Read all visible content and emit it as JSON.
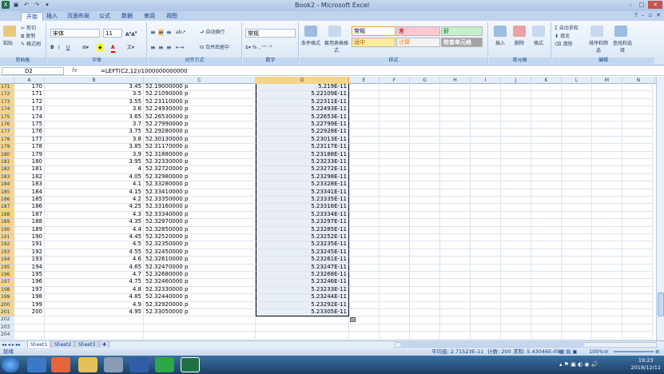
{
  "window": {
    "title": "Book2 - Microsoft Excel"
  },
  "tabs": [
    "开始",
    "插入",
    "页面布局",
    "公式",
    "数据",
    "审阅",
    "视图"
  ],
  "ribbon": {
    "clipboard": {
      "label": "剪贴板",
      "paste": "粘贴",
      "cut": "剪切",
      "copy": "复制",
      "format_painter": "格式刷"
    },
    "font": {
      "label": "字体",
      "name": "宋体",
      "size": "11"
    },
    "alignment": {
      "label": "对齐方式",
      "wrap": "自动换行",
      "merge": "合并后居中"
    },
    "number": {
      "label": "数字",
      "format": "常规"
    },
    "styles": {
      "label": "样式",
      "conditional": "条件格式",
      "table": "套用表格格式",
      "cells": {
        "normal": "常规",
        "bad": "差",
        "good": "好",
        "neutral": "适中",
        "calc": "计算",
        "check": "检查单元格"
      }
    },
    "cells": {
      "label": "单元格",
      "insert": "插入",
      "delete": "删除",
      "format": "格式"
    },
    "editing": {
      "label": "编辑",
      "autosum": "自动求和",
      "fill": "填充",
      "clear": "清除",
      "sort": "排序和筛选",
      "find": "查找和选择"
    }
  },
  "formula_bar": {
    "name_box": "D2",
    "fx": "fx",
    "formula": "=LEFT(C2,12)/1000000000000"
  },
  "columns": [
    "A",
    "B",
    "C",
    "D",
    "E",
    "F",
    "G",
    "H",
    "I",
    "J",
    "K",
    "L",
    "M",
    "N"
  ],
  "rows": [
    {
      "n": "171",
      "a": "170",
      "b": "3.45",
      "c": "52.19000000 p",
      "d": "5.219E-11"
    },
    {
      "n": "172",
      "a": "171",
      "b": "3.5",
      "c": "52.21090000 p",
      "d": "5.22109E-11"
    },
    {
      "n": "173",
      "a": "172",
      "b": "3.55",
      "c": "52.23110000 p",
      "d": "5.22311E-11"
    },
    {
      "n": "174",
      "a": "173",
      "b": "3.6",
      "c": "52.24930000 p",
      "d": "5.22493E-11"
    },
    {
      "n": "175",
      "a": "174",
      "b": "3.65",
      "c": "52.26530000 p",
      "d": "5.22653E-11"
    },
    {
      "n": "176",
      "a": "175",
      "b": "3.7",
      "c": "52.27990000 p",
      "d": "5.22799E-11"
    },
    {
      "n": "177",
      "a": "176",
      "b": "3.75",
      "c": "52.29280000 p",
      "d": "5.22928E-11"
    },
    {
      "n": "178",
      "a": "177",
      "b": "3.8",
      "c": "52.30130000 p",
      "d": "5.23013E-11"
    },
    {
      "n": "179",
      "a": "178",
      "b": "3.85",
      "c": "52.31170000 p",
      "d": "5.23117E-11"
    },
    {
      "n": "180",
      "a": "179",
      "b": "3.9",
      "c": "52.31880000 p",
      "d": "5.23188E-11"
    },
    {
      "n": "181",
      "a": "180",
      "b": "3.95",
      "c": "52.32330000 p",
      "d": "5.23233E-11"
    },
    {
      "n": "182",
      "a": "181",
      "b": "4",
      "c": "52.32720000 p",
      "d": "5.23272E-11"
    },
    {
      "n": "183",
      "a": "182",
      "b": "4.05",
      "c": "52.32980000 p",
      "d": "5.23298E-11"
    },
    {
      "n": "184",
      "a": "183",
      "b": "4.1",
      "c": "52.33280000 p",
      "d": "5.23328E-11"
    },
    {
      "n": "185",
      "a": "184",
      "b": "4.15",
      "c": "52.33410000 p",
      "d": "5.23341E-11"
    },
    {
      "n": "186",
      "a": "185",
      "b": "4.2",
      "c": "52.33350000 p",
      "d": "5.23335E-11"
    },
    {
      "n": "187",
      "a": "186",
      "b": "4.25",
      "c": "52.33160000 p",
      "d": "5.23316E-11"
    },
    {
      "n": "188",
      "a": "187",
      "b": "4.3",
      "c": "52.33340000 p",
      "d": "5.23334E-11"
    },
    {
      "n": "189",
      "a": "188",
      "b": "4.35",
      "c": "52.32970000 p",
      "d": "5.23297E-11"
    },
    {
      "n": "190",
      "a": "189",
      "b": "4.4",
      "c": "52.32850000 p",
      "d": "5.23285E-11"
    },
    {
      "n": "191",
      "a": "190",
      "b": "4.45",
      "c": "52.32520000 p",
      "d": "5.23252E-11"
    },
    {
      "n": "192",
      "a": "191",
      "b": "4.5",
      "c": "52.32350000 p",
      "d": "5.23235E-11"
    },
    {
      "n": "193",
      "a": "192",
      "b": "4.55",
      "c": "52.32450000 p",
      "d": "5.23245E-11"
    },
    {
      "n": "194",
      "a": "193",
      "b": "4.6",
      "c": "52.32610000 p",
      "d": "5.23261E-11"
    },
    {
      "n": "195",
      "a": "194",
      "b": "4.65",
      "c": "52.32470000 p",
      "d": "5.23247E-11"
    },
    {
      "n": "196",
      "a": "195",
      "b": "4.7",
      "c": "52.32680000 p",
      "d": "5.23268E-11"
    },
    {
      "n": "197",
      "a": "196",
      "b": "4.75",
      "c": "52.32460000 p",
      "d": "5.23246E-11"
    },
    {
      "n": "198",
      "a": "197",
      "b": "4.8",
      "c": "52.32330000 p",
      "d": "5.23233E-11"
    },
    {
      "n": "199",
      "a": "198",
      "b": "4.85",
      "c": "52.32440000 p",
      "d": "5.23244E-11"
    },
    {
      "n": "200",
      "a": "199",
      "b": "4.9",
      "c": "52.32920000 p",
      "d": "5.23292E-11"
    },
    {
      "n": "201",
      "a": "200",
      "b": "4.95",
      "c": "52.33050000 p",
      "d": "5.23305E-11"
    },
    {
      "n": "202",
      "a": "",
      "b": "",
      "c": "",
      "d": ""
    },
    {
      "n": "203",
      "a": "",
      "b": "",
      "c": "",
      "d": ""
    },
    {
      "n": "204",
      "a": "",
      "b": "",
      "c": "",
      "d": ""
    }
  ],
  "sheets": [
    "Sheet1",
    "Sheet2",
    "Sheet3"
  ],
  "status": {
    "ready": "就绪",
    "average": "平均值: 2.71523E-11",
    "count": "计数: 200",
    "sum": "求和: 5.43046E-09",
    "zoom": "100%"
  },
  "taskbar": {
    "time": "19:23",
    "date": "2018/12/11"
  }
}
